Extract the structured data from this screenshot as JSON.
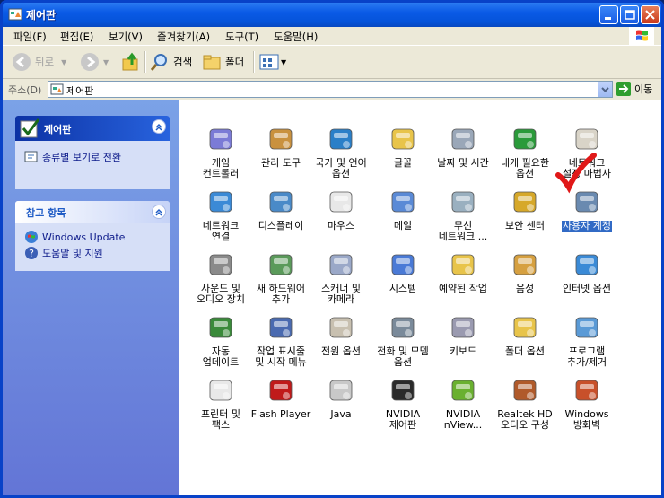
{
  "window": {
    "title": "제어판"
  },
  "menu": [
    "파일(F)",
    "편집(E)",
    "보기(V)",
    "즐겨찾기(A)",
    "도구(T)",
    "도움말(H)"
  ],
  "toolbar": {
    "back": "뒤로",
    "search": "검색",
    "folders": "폴더"
  },
  "address": {
    "label": "주소(D)",
    "value": "제어판",
    "go": "이동"
  },
  "left": {
    "panel1": {
      "title": "제어판",
      "link": "종류별 보기로 전환"
    },
    "panel2": {
      "title": "참고 항목",
      "links": [
        "Windows Update",
        "도움말 및 지원"
      ]
    }
  },
  "items": [
    [
      "게임\n컨트롤러",
      "관리 도구",
      "국가 및 언어\n옵션",
      "글꼴",
      "날짜 및 시간",
      "내게 필요한\n옵션",
      "네트워크\n설정 마법사"
    ],
    [
      "네트워크\n연결",
      "디스플레이",
      "마우스",
      "메일",
      "무선\n네트워크 ...",
      "보안 센터",
      "사용자 계정"
    ],
    [
      "사운드 및\n오디오 장치",
      "새 하드웨어\n추가",
      "스캐너 및\n카메라",
      "시스템",
      "예약된 작업",
      "음성",
      "인터넷 옵션"
    ],
    [
      "자동\n업데이트",
      "작업 표시줄\n및 시작 메뉴",
      "전원 옵션",
      "전화 및 모뎀\n옵션",
      "키보드",
      "폴더 옵션",
      "프로그램\n추가/제거"
    ],
    [
      "프린터 및\n팩스",
      "Flash Player",
      "Java",
      "NVIDIA\n제어판",
      "NVIDIA\nnView...",
      "Realtek HD\n오디오 구성",
      "Windows\n방화벽"
    ]
  ],
  "selected_item": "사용자 계정"
}
